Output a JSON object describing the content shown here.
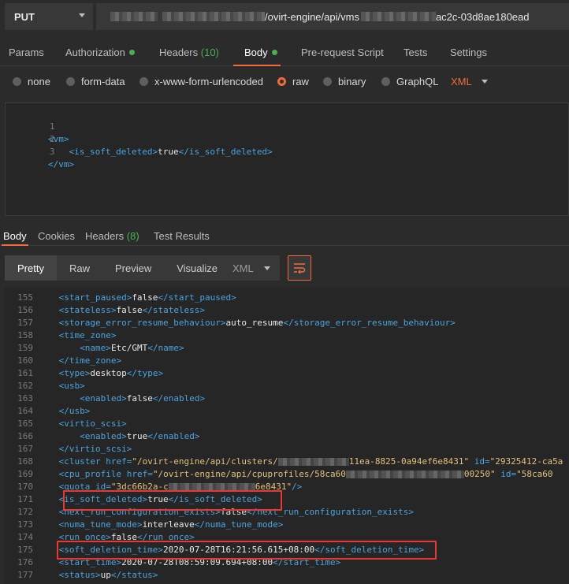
{
  "request": {
    "method": "PUT",
    "url_visible_mid": "/ovirt-engine/api/vms",
    "url_visible_end": "ac2c-03d8ae180ead"
  },
  "request_tabs": [
    {
      "label": "Params"
    },
    {
      "label": "Authorization",
      "dot": true
    },
    {
      "label": "Headers",
      "count": "(10)"
    },
    {
      "label": "Body",
      "dot": true,
      "active": true
    },
    {
      "label": "Pre-request Script"
    },
    {
      "label": "Tests"
    },
    {
      "label": "Settings"
    }
  ],
  "body_types": [
    "none",
    "form-data",
    "x-www-form-urlencoded",
    "raw",
    "binary",
    "GraphQL"
  ],
  "body_type_selected": "raw",
  "body_language": "XML",
  "request_body": [
    {
      "n": "1",
      "indent": "",
      "tag_open": "<vm>"
    },
    {
      "n": "2",
      "indent": "    ",
      "tag_open": "<is_soft_deleted>",
      "value": "true",
      "tag_close": "</is_soft_deleted>"
    },
    {
      "n": "3",
      "indent": "",
      "tag_open": "</vm>"
    }
  ],
  "response_tabs": [
    {
      "label": "Body",
      "active": true
    },
    {
      "label": "Cookies"
    },
    {
      "label": "Headers",
      "count": "(8)"
    },
    {
      "label": "Test Results"
    }
  ],
  "view_modes": [
    "Pretty",
    "Raw",
    "Preview",
    "Visualize"
  ],
  "view_mode_active": "Pretty",
  "response_format": "XML",
  "response_lines": [
    {
      "n": "155",
      "i": 4,
      "o": "<start_paused>",
      "v": "false",
      "c": "</start_paused>"
    },
    {
      "n": "156",
      "i": 4,
      "o": "<stateless>",
      "v": "false",
      "c": "</stateless>"
    },
    {
      "n": "157",
      "i": 4,
      "o": "<storage_error_resume_behaviour>",
      "v": "auto_resume",
      "c": "</storage_error_resume_behaviour>"
    },
    {
      "n": "158",
      "i": 4,
      "o": "<time_zone>"
    },
    {
      "n": "159",
      "i": 8,
      "o": "<name>",
      "v": "Etc/GMT",
      "c": "</name>"
    },
    {
      "n": "160",
      "i": 4,
      "o": "</time_zone>"
    },
    {
      "n": "161",
      "i": 4,
      "o": "<type>",
      "v": "desktop",
      "c": "</type>"
    },
    {
      "n": "162",
      "i": 4,
      "o": "<usb>"
    },
    {
      "n": "163",
      "i": 8,
      "o": "<enabled>",
      "v": "false",
      "c": "</enabled>"
    },
    {
      "n": "164",
      "i": 4,
      "o": "</usb>"
    },
    {
      "n": "165",
      "i": 4,
      "o": "<virtio_scsi>"
    },
    {
      "n": "166",
      "i": 8,
      "o": "<enabled>",
      "v": "true",
      "c": "</enabled>"
    },
    {
      "n": "167",
      "i": 4,
      "o": "</virtio_scsi>"
    },
    {
      "n": "168",
      "i": 4,
      "o": "<cluster",
      "a1": " href=",
      "v1": "\"/ovirt-engine/api/clusters/",
      "v2": "11ea-8825-0a94ef6e8431\"",
      "a2": " id=",
      "v3": "\"29325412-ca5a"
    },
    {
      "n": "169",
      "i": 4,
      "o": "<cpu_profile",
      "a1": " href=",
      "v1": "\"/ovirt-engine/api/cpuprofiles/58ca60",
      "v2": "00250\"",
      "a2": " id=",
      "v3": "\"58ca60"
    },
    {
      "n": "170",
      "i": 4,
      "o": "<quota",
      "a1": " id=",
      "v1": "\"3dc66b2a-c",
      "v2": "6e8431\"",
      "c": "/>"
    },
    {
      "n": "171",
      "i": 4,
      "o": "<is_soft_deleted>",
      "v": "true",
      "c": "</is_soft_deleted>"
    },
    {
      "n": "172",
      "i": 4,
      "o": "<next_run_configuration_exists>",
      "v": "false",
      "c": "</next_run_configuration_exists>"
    },
    {
      "n": "173",
      "i": 4,
      "o": "<numa_tune_mode>",
      "v": "interleave",
      "c": "</numa_tune_mode>"
    },
    {
      "n": "174",
      "i": 4,
      "o": "<run_once>",
      "v": "false",
      "c": "</run_once>"
    },
    {
      "n": "175",
      "i": 4,
      "o": "<soft_deletion_time>",
      "v": "2020-07-28T16:21:56.615+08:00",
      "c": "</soft_deletion_time>"
    },
    {
      "n": "176",
      "i": 4,
      "o": "<start_time>",
      "v": "2020-07-28T08:59:09.694+08:00",
      "c": "</start_time>"
    },
    {
      "n": "177",
      "i": 4,
      "o": "<status>",
      "v": "up",
      "c": "</status>"
    }
  ],
  "colors": {
    "accent": "#f26b3a",
    "status_green": "#4caf50",
    "tag": "#4aa3df",
    "highlight_box": "#e53935"
  }
}
